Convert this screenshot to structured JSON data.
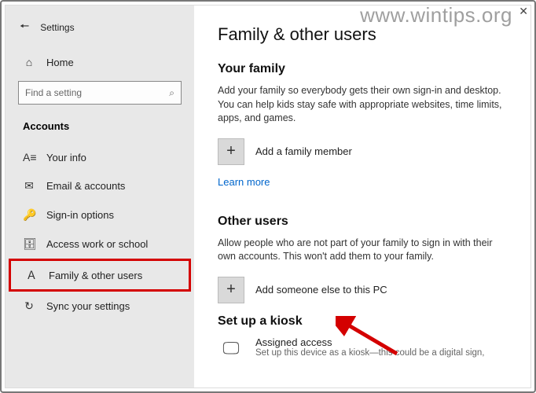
{
  "watermark": "www.wintips.org",
  "header": {
    "title": "Settings"
  },
  "home": {
    "label": "Home"
  },
  "search": {
    "placeholder": "Find a setting"
  },
  "category": "Accounts",
  "nav": [
    {
      "label": "Your info"
    },
    {
      "label": "Email & accounts"
    },
    {
      "label": "Sign-in options"
    },
    {
      "label": "Access work or school"
    },
    {
      "label": "Family & other users"
    },
    {
      "label": "Sync your settings"
    }
  ],
  "page": {
    "title": "Family & other users",
    "family": {
      "title": "Your family",
      "desc": "Add your family so everybody gets their own sign-in and desktop. You can help kids stay safe with appropriate websites, time limits, apps, and games.",
      "add_label": "Add a family member",
      "learn_more": "Learn more"
    },
    "other": {
      "title": "Other users",
      "desc": "Allow people who are not part of your family to sign in with their own accounts. This won't add them to your family.",
      "add_label": "Add someone else to this PC"
    },
    "kiosk": {
      "title": "Set up a kiosk",
      "item_title": "Assigned access",
      "item_desc": "Set up this device as a kiosk—this could be a digital sign,"
    }
  }
}
